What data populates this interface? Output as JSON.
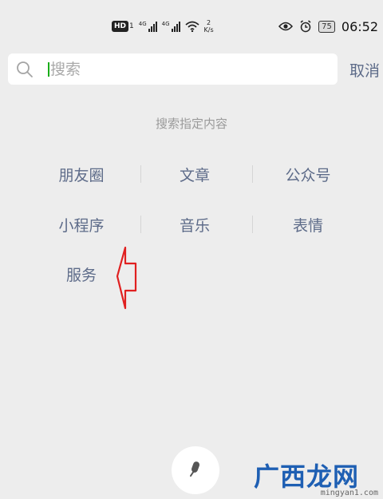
{
  "status_bar": {
    "hd": "HD",
    "sim_number": "1",
    "net1": "4G",
    "net2": "4G",
    "speed_value": "2",
    "speed_unit": "K/s",
    "battery": "75",
    "time": "06:52",
    "icons": [
      "eye-icon",
      "alarm-icon",
      "wifi-icon",
      "signal-icon",
      "battery-icon"
    ]
  },
  "search": {
    "placeholder": "搜索",
    "value": "",
    "cancel_label": "取消"
  },
  "section": {
    "title": "搜索指定内容",
    "categories": [
      "朋友圈",
      "文章",
      "公众号",
      "小程序",
      "音乐",
      "表情",
      "服务"
    ]
  },
  "voice_icon": "microphone-icon",
  "watermark": {
    "logo": "广西龙网",
    "url": "mingyan1.com"
  },
  "colors": {
    "background": "#ededed",
    "link": "#5d6b89",
    "cursor": "#1aad19",
    "annotation_arrow": "#e02020"
  }
}
